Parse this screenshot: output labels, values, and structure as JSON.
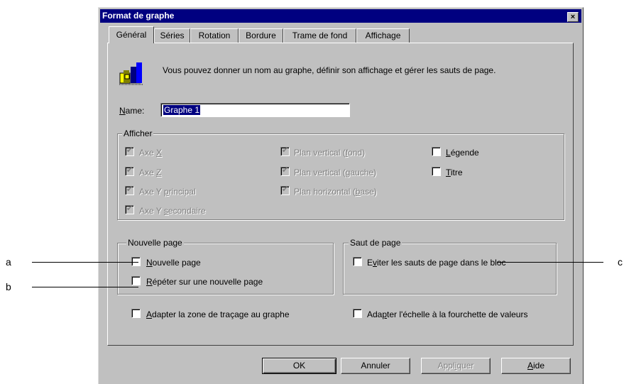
{
  "window": {
    "title": "Format de graphe",
    "close_glyph": "×"
  },
  "tabs": [
    {
      "label": "Général",
      "active": true
    },
    {
      "label": "Séries"
    },
    {
      "label": "Rotation"
    },
    {
      "label": "Bordure"
    },
    {
      "label": "Trame de fond"
    },
    {
      "label": "Affichage"
    }
  ],
  "intro": {
    "text": "Vous pouvez donner un nom au graphe, définir son affichage et gérer les sauts de page.",
    "icon": "chart-icon"
  },
  "name_field": {
    "label_first": "N",
    "label_rest": "ame:",
    "value": "Graphe 1"
  },
  "afficher": {
    "title": "Afficher",
    "axe_x": {
      "pre": "Axe ",
      "key": "X",
      "post": "",
      "checked": true,
      "enabled": false
    },
    "axe_z": {
      "pre": "Axe ",
      "key": "Z",
      "post": "",
      "checked": true,
      "enabled": false
    },
    "axe_y_principal": {
      "pre": "Axe Y ",
      "key": "p",
      "post": "rincipal",
      "checked": true,
      "enabled": false
    },
    "axe_y_secondaire": {
      "pre": "Axe Y ",
      "key": "s",
      "post": "econdaire",
      "checked": true,
      "enabled": false
    },
    "plan_vertical_fond": {
      "pre": "Plan vertical (",
      "key": "f",
      "post": "ond)",
      "checked": true,
      "enabled": false
    },
    "plan_vertical_gauche": {
      "pre": "Plan vertical (",
      "key": "g",
      "post": "auche)",
      "checked": true,
      "enabled": false
    },
    "plan_horizontal_base": {
      "pre": "Plan horizontal (",
      "key": "b",
      "post": "ase)",
      "checked": true,
      "enabled": false
    },
    "legende": {
      "pre": "",
      "key": "L",
      "post": "égende",
      "checked": false,
      "enabled": true
    },
    "titre": {
      "pre": "",
      "key": "T",
      "post": "itre",
      "checked": false,
      "enabled": true
    }
  },
  "nouvelle_page_group": {
    "title": "Nouvelle page",
    "nouvelle_page": {
      "pre": "",
      "key": "N",
      "post": "ouvelle page",
      "checked": false
    },
    "repeter": {
      "pre": "",
      "key": "R",
      "post": "épéter sur une nouvelle page",
      "checked": false
    }
  },
  "saut_page_group": {
    "title": "Saut de page",
    "eviter": {
      "pre": "E",
      "key": "v",
      "post": "iter les sauts de page dans le bloc",
      "checked": false
    }
  },
  "adapter_zone": {
    "pre": "",
    "key": "A",
    "post": "dapter la zone de traçage au graphe",
    "checked": false
  },
  "adapter_echelle": {
    "pre": "Ada",
    "key": "p",
    "post": "ter l'échelle à la fourchette de valeurs",
    "checked": false
  },
  "buttons": {
    "ok": "OK",
    "annuler": "Annuler",
    "appliquer_pre": "Appl",
    "appliquer_key": "i",
    "appliquer_post": "quer",
    "aide_key": "A",
    "aide_post": "ide"
  },
  "callouts": {
    "a": "a",
    "b": "b",
    "c": "c"
  },
  "check_mark": "✔"
}
